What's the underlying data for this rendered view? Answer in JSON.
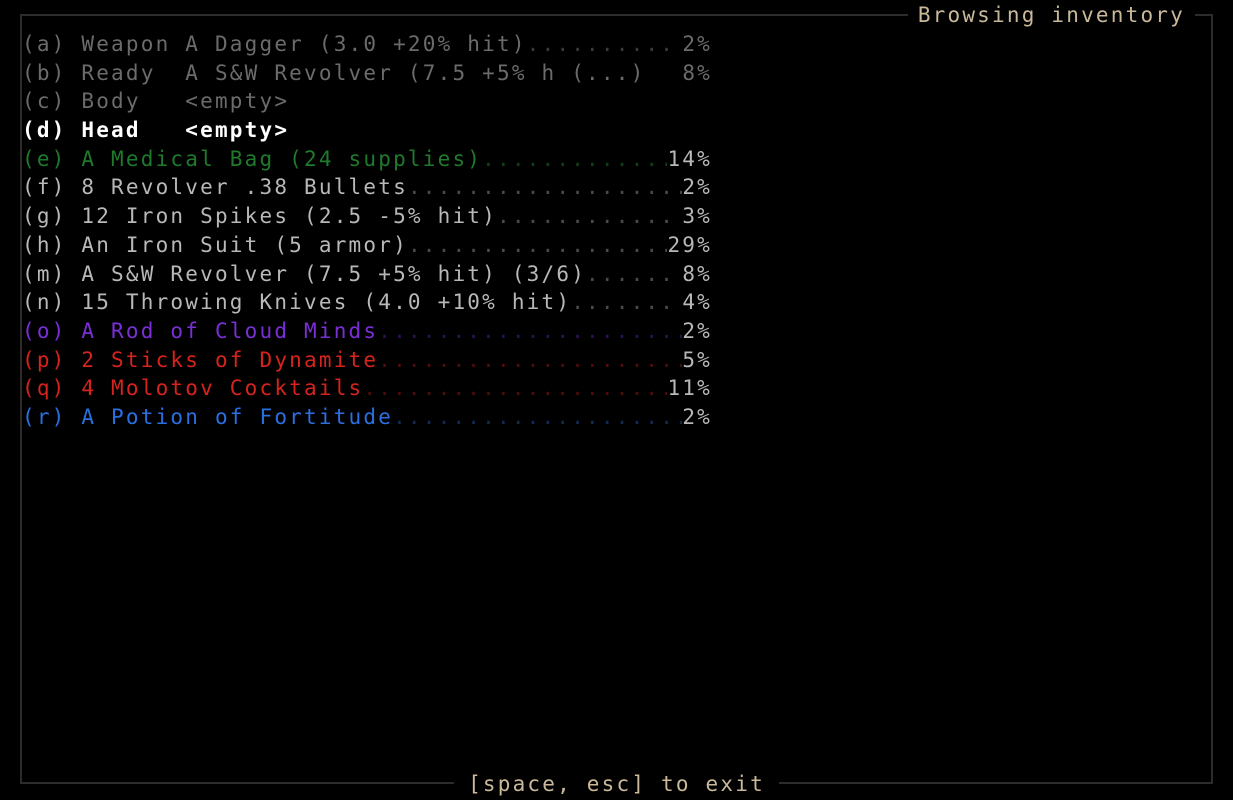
{
  "window": {
    "title": "Browsing inventory",
    "footer_hint": "[space, esc] to exit",
    "background_color": "#000000",
    "border_color": "#2e2c2a",
    "title_color": "#c9b999"
  },
  "inventory": {
    "rows": [
      {
        "key": "(a)",
        "slot": " Weapon ",
        "label": "A Dagger (3.0 +20% hit)",
        "leader": "..........",
        "percent": "2%",
        "name_class": "c-dim",
        "leader_class": "leader-dim",
        "pct_class": "pct-dim"
      },
      {
        "key": "(b)",
        "slot": " Ready  ",
        "label": "A S&W Revolver (7.5 +5% h (...)",
        "leader": " ",
        "percent": "8%",
        "name_class": "c-dim",
        "leader_class": "leader-dim",
        "pct_class": "pct-dim"
      },
      {
        "key": "(c)",
        "slot": " Body   ",
        "label": "<empty>",
        "leader": "",
        "percent": "",
        "name_class": "c-dim",
        "leader_class": "leader-dim",
        "pct_class": "pct-dim"
      },
      {
        "key": "(d)",
        "slot": " Head   ",
        "label": "<empty>",
        "leader": "",
        "percent": "",
        "name_class": "c-bright",
        "leader_class": "leader-normal",
        "pct_class": "pct-normal"
      },
      {
        "key": "(e)",
        "slot": " ",
        "label": "A Medical Bag (24 supplies)",
        "leader": ".............",
        "percent": "14%",
        "name_class": "c-green",
        "leader_class": "leader-green",
        "pct_class": "pct-normal"
      },
      {
        "key": "(f)",
        "slot": " ",
        "label": "8 Revolver .38 Bullets",
        "leader": "...................",
        "percent": "2%",
        "name_class": "c-normal",
        "leader_class": "leader-normal",
        "pct_class": "pct-normal"
      },
      {
        "key": "(g)",
        "slot": " ",
        "label": "12 Iron Spikes (2.5 -5% hit)",
        "leader": "............",
        "percent": "3%",
        "name_class": "c-normal",
        "leader_class": "leader-normal",
        "pct_class": "pct-normal"
      },
      {
        "key": "(h)",
        "slot": " ",
        "label": "An Iron Suit (5 armor)",
        "leader": "..................",
        "percent": "29%",
        "name_class": "c-normal",
        "leader_class": "leader-normal",
        "pct_class": "pct-normal"
      },
      {
        "key": "(m)",
        "slot": " ",
        "label": "A S&W Revolver (7.5 +5% hit) (3/6)",
        "leader": "......",
        "percent": "8%",
        "name_class": "c-normal",
        "leader_class": "leader-normal",
        "pct_class": "pct-normal"
      },
      {
        "key": "(n)",
        "slot": " ",
        "label": "15 Throwing Knives (4.0 +10% hit)",
        "leader": ".......",
        "percent": "4%",
        "name_class": "c-normal",
        "leader_class": "leader-normal",
        "pct_class": "pct-normal"
      },
      {
        "key": "(o)",
        "slot": " ",
        "label": "A Rod of Cloud Minds",
        "leader": ".....................",
        "percent": "2%",
        "name_class": "c-purple",
        "leader_class": "leader-purple",
        "pct_class": "pct-normal"
      },
      {
        "key": "(p)",
        "slot": " ",
        "label": "2 Sticks of Dynamite",
        "leader": ".....................",
        "percent": "5%",
        "name_class": "c-red",
        "leader_class": "leader-red",
        "pct_class": "pct-normal"
      },
      {
        "key": "(q)",
        "slot": " ",
        "label": "4 Molotov Cocktails",
        "leader": ".....................",
        "percent": "11%",
        "name_class": "c-red",
        "leader_class": "leader-red",
        "pct_class": "pct-normal"
      },
      {
        "key": "(r)",
        "slot": " ",
        "label": "A Potion of Fortitude",
        "leader": "....................",
        "percent": "2%",
        "name_class": "c-blue",
        "leader_class": "leader-blue",
        "pct_class": "pct-normal"
      }
    ]
  }
}
